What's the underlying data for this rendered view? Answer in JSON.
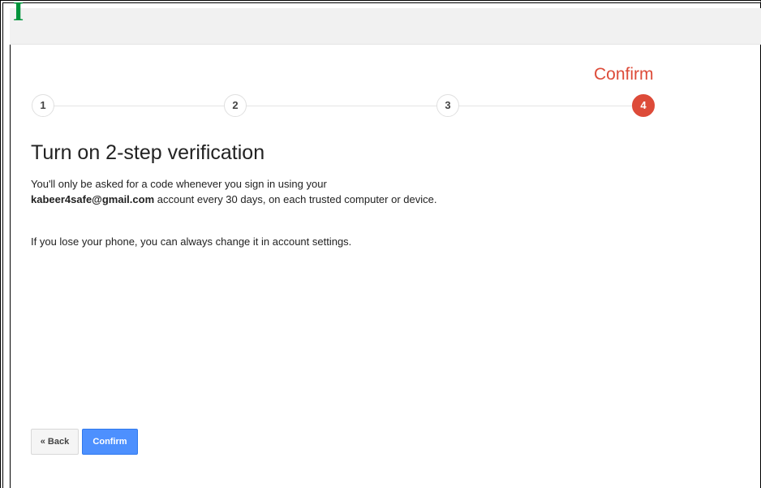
{
  "header": {
    "logo_fragment": "IC"
  },
  "wizard": {
    "current_step_title": "Confirm",
    "steps": [
      {
        "label": "1"
      },
      {
        "label": "2"
      },
      {
        "label": "3"
      },
      {
        "label": "4"
      }
    ],
    "active_step": 4
  },
  "content": {
    "title": "Turn on 2-step verification",
    "para1_before": "You'll only be asked for a code whenever you sign in using your",
    "email": "kabeer4safe@gmail.com",
    "para1_after": "account every 30 days, on each trusted computer or device.",
    "para2": "If you lose your phone, you can always change it in account settings."
  },
  "buttons": {
    "back_label": "« Back",
    "confirm_label": "Confirm"
  },
  "colors": {
    "accent_red": "#dd4b39",
    "confirm_blue": "#4d90fe"
  }
}
